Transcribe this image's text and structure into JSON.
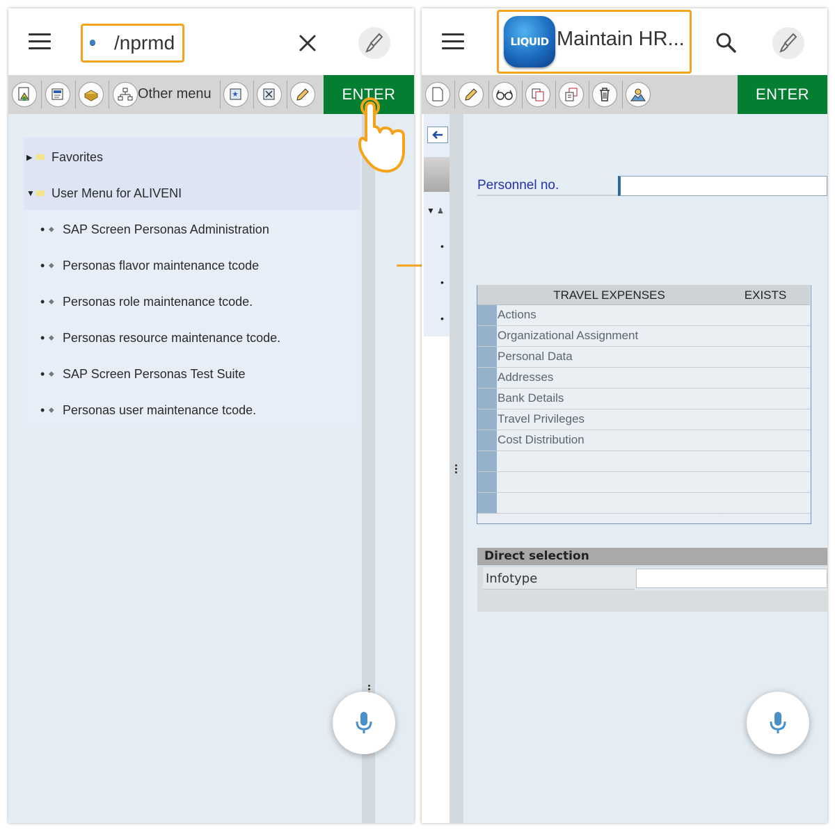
{
  "left": {
    "command_field": "/nprmd",
    "toolbar": {
      "other_menu_label": "Other menu",
      "enter_label": "ENTER"
    },
    "tree": {
      "favorites": "Favorites",
      "user_menu": "User Menu for ALIVENI",
      "items": [
        "SAP Screen Personas Administration",
        "Personas flavor maintenance tcode",
        "Personas role maintenance tcode.",
        "Personas resource maintenance tcode.",
        "SAP Screen Personas Test Suite",
        "Personas user maintenance tcode."
      ]
    }
  },
  "right": {
    "logo_text": "LIQUID",
    "title": "Maintain HR...",
    "toolbar": {
      "enter_label": "ENTER"
    },
    "personnel_label": "Personnel no.",
    "personnel_value": "",
    "table": {
      "headers": [
        "TRAVEL EXPENSES",
        "EXISTS"
      ],
      "rows": [
        "Actions",
        "Organizational Assignment",
        "Personal Data",
        "Addresses",
        "Bank Details",
        "Travel Privileges",
        "Cost Distribution",
        "",
        "",
        ""
      ]
    },
    "direct_selection": {
      "title": "Direct selection",
      "infotype_label": "Infotype",
      "infotype_value": ""
    }
  },
  "colors": {
    "accent": "#f5a31a",
    "enter_green": "#047f32",
    "link_blue": "#2331a9",
    "mic_blue": "#4a90c8"
  }
}
